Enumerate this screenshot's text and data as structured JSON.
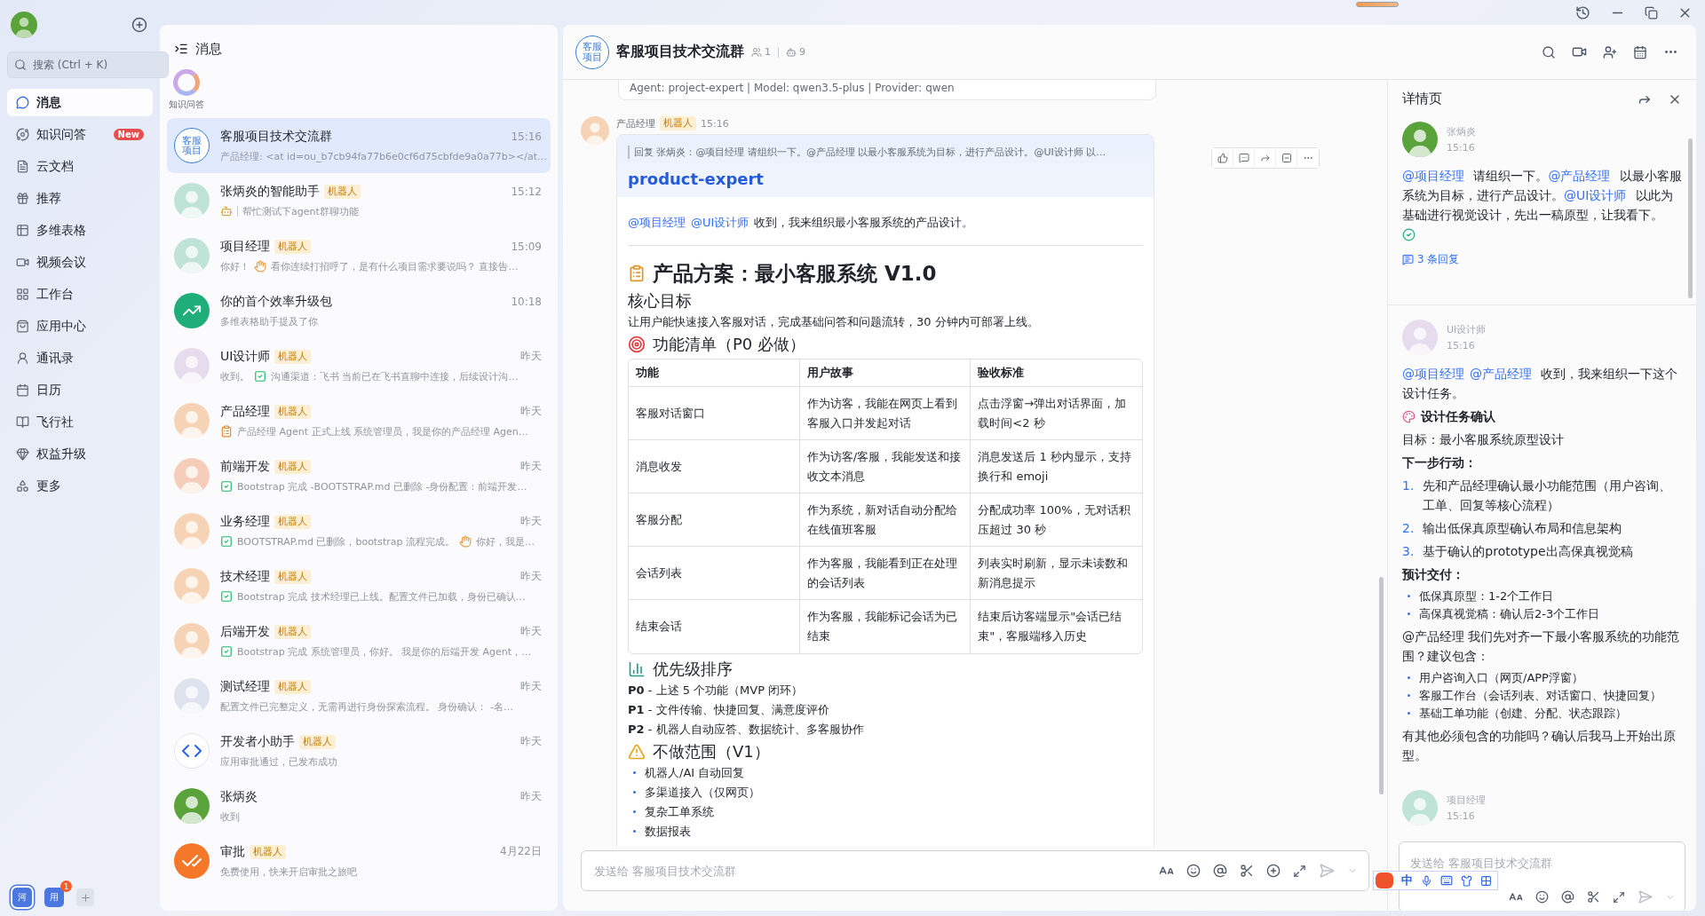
{
  "nav": {
    "search": {
      "placeholder": "搜索 (Ctrl + K)"
    },
    "items": [
      {
        "kind": "chat",
        "label": "消息",
        "selected": true
      },
      {
        "kind": "qa",
        "label": "知识问答",
        "selected": false,
        "badge": "New"
      },
      {
        "kind": "docs",
        "label": "云文档",
        "selected": false
      },
      {
        "kind": "feed",
        "label": "推荐",
        "selected": false
      },
      {
        "kind": "base",
        "label": "多维表格",
        "selected": false
      },
      {
        "kind": "meeting",
        "label": "视频会议",
        "selected": false
      },
      {
        "kind": "workplace",
        "label": "工作台",
        "selected": false
      },
      {
        "kind": "apps",
        "label": "应用中心",
        "selected": false
      },
      {
        "kind": "contacts",
        "label": "通讯录",
        "selected": false
      },
      {
        "kind": "calendar",
        "label": "日历",
        "selected": false
      },
      {
        "kind": "wiki",
        "label": "飞行社",
        "selected": false
      },
      {
        "kind": "upgrade",
        "label": "权益升级",
        "selected": false
      },
      {
        "kind": "more",
        "label": "更多",
        "selected": false
      }
    ],
    "workspaces": [
      {
        "label": "河",
        "selected": true
      },
      {
        "label": "用",
        "selected": false,
        "badge": "1"
      }
    ]
  },
  "chat_list": {
    "title": "消息",
    "pinned": [
      {
        "label": "知识问答"
      }
    ],
    "chats": [
      {
        "name": "客服项目技术交流群",
        "time": "15:16",
        "selected": true,
        "avatar": {
          "kind": "group",
          "text": "客服项目",
          "color": "#3a7bd5"
        },
        "preview": [
          {
            "kind": "text",
            "text": "产品经理: <at id=ou_b7cb94fa77b6e0cf6d75cbfde9a0a77b></at…"
          }
        ]
      },
      {
        "name": "张炳炎的智能助手",
        "bot_tag": "机器人",
        "time": "15:12",
        "selected": false,
        "avatar": {
          "kind": "person",
          "color": "#bfe3d6"
        },
        "preview": [
          {
            "kind": "robot"
          },
          {
            "kind": "sep"
          },
          {
            "kind": "text",
            "text": "帮忙测试下agent群聊功能"
          }
        ]
      },
      {
        "name": "项目经理",
        "bot_tag": "机器人",
        "time": "15:09",
        "selected": false,
        "avatar": {
          "kind": "person",
          "color": "#bfe3d6"
        },
        "preview": [
          {
            "kind": "text",
            "text": "你好！"
          },
          {
            "kind": "wave"
          },
          {
            "kind": "text",
            "text": "看你连续打招呼了，是有什么项目需求要说吗？ 直接告…"
          }
        ]
      },
      {
        "name": "你的首个效率升级包",
        "time": "10:18",
        "selected": false,
        "avatar": {
          "kind": "chart",
          "color": "#1fae7a"
        },
        "preview": [
          {
            "kind": "text",
            "text": "多维表格助手提及了你"
          }
        ]
      },
      {
        "name": "UI设计师",
        "bot_tag": "机器人",
        "time": "昨天",
        "selected": false,
        "avatar": {
          "kind": "person",
          "color": "#e6dcee"
        },
        "preview": [
          {
            "kind": "text",
            "text": "收到。"
          },
          {
            "kind": "check"
          },
          {
            "kind": "text",
            "text": "沟通渠道：飞书 当前已在飞书直聊中连接，后续设计沟…"
          }
        ]
      },
      {
        "name": "产品经理",
        "bot_tag": "机器人",
        "time": "昨天",
        "selected": false,
        "avatar": {
          "kind": "person",
          "color": "#f7d3b5"
        },
        "preview": [
          {
            "kind": "doc"
          },
          {
            "kind": "text",
            "text": "产品经理 Agent 正式上线 系统管理员，我是你的产品经理 Agen…"
          }
        ]
      },
      {
        "name": "前端开发",
        "bot_tag": "机器人",
        "time": "昨天",
        "selected": false,
        "avatar": {
          "kind": "person",
          "color": "#f5cdb8"
        },
        "preview": [
          {
            "kind": "check"
          },
          {
            "kind": "text",
            "text": "Bootstrap 完成 -BOOTSTRAP.md 已删除 -身份配置：前端开发…"
          }
        ]
      },
      {
        "name": "业务经理",
        "bot_tag": "机器人",
        "time": "昨天",
        "selected": false,
        "avatar": {
          "kind": "person",
          "color": "#f7d3b5"
        },
        "preview": [
          {
            "kind": "check"
          },
          {
            "kind": "text",
            "text": "BOOTSTRAP.md 已删除，bootstrap 流程完成。"
          },
          {
            "kind": "wave"
          },
          {
            "kind": "text",
            "text": "你好，我是…"
          }
        ]
      },
      {
        "name": "技术经理",
        "bot_tag": "机器人",
        "time": "昨天",
        "selected": false,
        "avatar": {
          "kind": "person",
          "color": "#f7d3b5"
        },
        "preview": [
          {
            "kind": "check"
          },
          {
            "kind": "text",
            "text": "Bootstrap 完成 技术经理已上线。配置文件已加载，身份已确认…"
          }
        ]
      },
      {
        "name": "后端开发",
        "bot_tag": "机器人",
        "time": "昨天",
        "selected": false,
        "avatar": {
          "kind": "person",
          "color": "#f7d3b5"
        },
        "preview": [
          {
            "kind": "check"
          },
          {
            "kind": "text",
            "text": "Bootstrap 完成 系统管理员，你好。 我是你的后端开发 Agent，…"
          }
        ]
      },
      {
        "name": "测试经理",
        "bot_tag": "机器人",
        "time": "昨天",
        "selected": false,
        "avatar": {
          "kind": "person",
          "color": "#dfe3f0"
        },
        "preview": [
          {
            "kind": "text",
            "text": "配置文件已完整定义，无需再进行身份探索流程。 身份确认： -名…"
          }
        ]
      },
      {
        "name": "开发者小助手",
        "bot_tag": "机器人",
        "time": "昨天",
        "selected": false,
        "avatar": {
          "kind": "code",
          "color": "#ffffff"
        },
        "preview": [
          {
            "kind": "text",
            "text": "应用审批通过，已发布成功"
          }
        ]
      },
      {
        "name": "张炳炎",
        "time": "昨天",
        "selected": false,
        "avatar": {
          "kind": "person",
          "color": "#5aa33a"
        },
        "preview": [
          {
            "kind": "text",
            "text": "收到"
          }
        ]
      },
      {
        "name": "审批",
        "bot_tag": "机器人",
        "time": "4月22日",
        "selected": false,
        "avatar": {
          "kind": "approval",
          "color": "#f5782a"
        },
        "preview": [
          {
            "kind": "text",
            "text": "免费使用，快来开启审批之旅吧"
          }
        ]
      }
    ]
  },
  "chat": {
    "title": "客服项目技术交流群",
    "avatar_text": "客服项目",
    "members": "1",
    "bots": "9",
    "prev_message": "Agent: project-expert | Model: qwen3.5-plus | Provider: qwen",
    "message": {
      "sender": "产品经理",
      "bot_tag": "机器人",
      "time": "15:16",
      "avatar": {
        "kind": "person",
        "color": "#f7d3b5"
      },
      "reply_quote": "回复 张炳炎：@项目经理 请组织一下。@产品经理 以最小客服系统为目标，进行产品设计。@UI设计师 以…",
      "agent": "product-expert",
      "intro": [
        {
          "kind": "mention",
          "text": "@项目经理"
        },
        {
          "kind": "mention",
          "text": "@UI设计师"
        },
        {
          "kind": "text",
          "text": "收到，我来组织最小客服系统的产品设计。"
        }
      ],
      "blocks": [
        {
          "kind": "h1",
          "text": "产品方案：最小客服系统 V1.0"
        },
        {
          "kind": "h2",
          "text": "核心目标"
        },
        {
          "kind": "p",
          "text": "让用户能快速接入客服对话，完成基础问答和问题流转，30 分钟内可部署上线。"
        },
        {
          "kind": "h2",
          "text": "功能清单（P0 必做）"
        },
        {
          "kind": "table",
          "columns": [
            "功能",
            "用户故事",
            "验收标准"
          ],
          "rows": [
            [
              "客服对话窗口",
              "作为访客，我能在网页上看到客服入口并发起对话",
              "点击浮窗→弹出对话界面，加载时间<2 秒"
            ],
            [
              "消息收发",
              "作为访客/客服，我能发送和接收文本消息",
              "消息发送后 1 秒内显示，支持换行和 emoji"
            ],
            [
              "客服分配",
              "作为系统，新对话自动分配给在线值班客服",
              "分配成功率 100%，无对话积压超过 30 秒"
            ],
            [
              "会话列表",
              "作为客服，我能看到正在处理的会话列表",
              "列表实时刷新，显示未读数和新消息提示"
            ],
            [
              "结束会话",
              "作为客服，我能标记会话为已结束",
              "结束后访客端显示\"会话已结束\"，客服端移入历史"
            ]
          ]
        },
        {
          "kind": "h2",
          "text": "优先级排序"
        },
        {
          "kind": "p",
          "text": "**P0** - 上述 5 个功能（MVP 闭环）"
        },
        {
          "kind": "p",
          "text": "**P1** - 文件传输、快捷回复、满意度评价"
        },
        {
          "kind": "p",
          "text": "**P2** - 机器人自动应答、数据统计、多客服协作"
        },
        {
          "kind": "h2",
          "text": "不做范围（V1）"
        },
        {
          "kind": "ul",
          "items": [
            "机器人/AI 自动回复",
            "多渠道接入（仅网页）",
            "复杂工单系统",
            "数据报表"
          ]
        }
      ]
    },
    "input": {
      "placeholder": "发送给 客服项目技术交流群"
    }
  },
  "detail": {
    "title": "详情页",
    "messages": [
      {
        "sender": "张炳炎",
        "time": "15:16",
        "avatar": {
          "kind": "person",
          "color": "#5aa33a"
        },
        "verified": true,
        "replies": "3 条回复",
        "blocks": [
          {
            "kind": "p",
            "parts": [
              {
                "kind": "mention",
                "text": "@项目经理"
              },
              {
                "kind": "text",
                "text": " 请组织一下。"
              },
              {
                "kind": "mention",
                "text": "@产品经理"
              },
              {
                "kind": "text",
                "text": " 以最小客服系统为目标，进行产品设计。"
              },
              {
                "kind": "mention",
                "text": "@UI设计师"
              },
              {
                "kind": "text",
                "text": " 以此为基础进行视觉设计，先出一稿原型，让我看下。"
              }
            ]
          }
        ]
      },
      {
        "sender": "UI设计师",
        "time": "15:16",
        "avatar": {
          "kind": "person",
          "color": "#e6dcee"
        },
        "verified": false,
        "blocks": [
          {
            "kind": "p",
            "parts": [
              {
                "kind": "mention",
                "text": "@项目经理"
              },
              {
                "kind": "mention",
                "text": "@产品经理"
              },
              {
                "kind": "text",
                "text": " 收到，我来组织一下这个设计任务。"
              }
            ]
          },
          {
            "kind": "heading",
            "text": "设计任务确认"
          },
          {
            "kind": "p",
            "parts": [
              {
                "kind": "text",
                "text": "目标：最小客服系统原型设计"
              }
            ]
          },
          {
            "kind": "bold",
            "text": "下一步行动："
          },
          {
            "kind": "ol",
            "items": [
              {
                "num": "1.",
                "text": "先和产品经理确认最小功能范围（用户咨询、工单、回复等核心流程）"
              },
              {
                "num": "2.",
                "text": "输出低保真原型确认布局和信息架构"
              },
              {
                "num": "3.",
                "text": "基于确认的prototype出高保真视觉稿"
              }
            ]
          },
          {
            "kind": "bold",
            "text": "预计交付："
          },
          {
            "kind": "ul",
            "items": [
              "低保真原型：1-2个工作日",
              "高保真视觉稿：确认后2-3个工作日"
            ]
          },
          {
            "kind": "p",
            "parts": [
              {
                "kind": "text",
                "text": "@产品经理 我们先对齐一下最小客服系统的功能范围？建议包含："
              }
            ]
          },
          {
            "kind": "ul",
            "items": [
              "用户咨询入口（网页/APP浮窗）",
              "客服工作台（会话列表、对话窗口、快捷回复）",
              "基础工单功能（创建、分配、状态跟踪）"
            ]
          },
          {
            "kind": "p",
            "parts": [
              {
                "kind": "text",
                "text": "有其他必须包含的功能吗？确认后我马上开始出原型。"
              }
            ]
          }
        ]
      },
      {
        "sender": "项目经理",
        "time": "15:16",
        "avatar": {
          "kind": "person",
          "color": "#bfe3d6"
        },
        "verified": false
      }
    ],
    "input": {
      "placeholder": "发送给 客服项目技术交流群"
    }
  },
  "ime": {
    "label": "中"
  }
}
